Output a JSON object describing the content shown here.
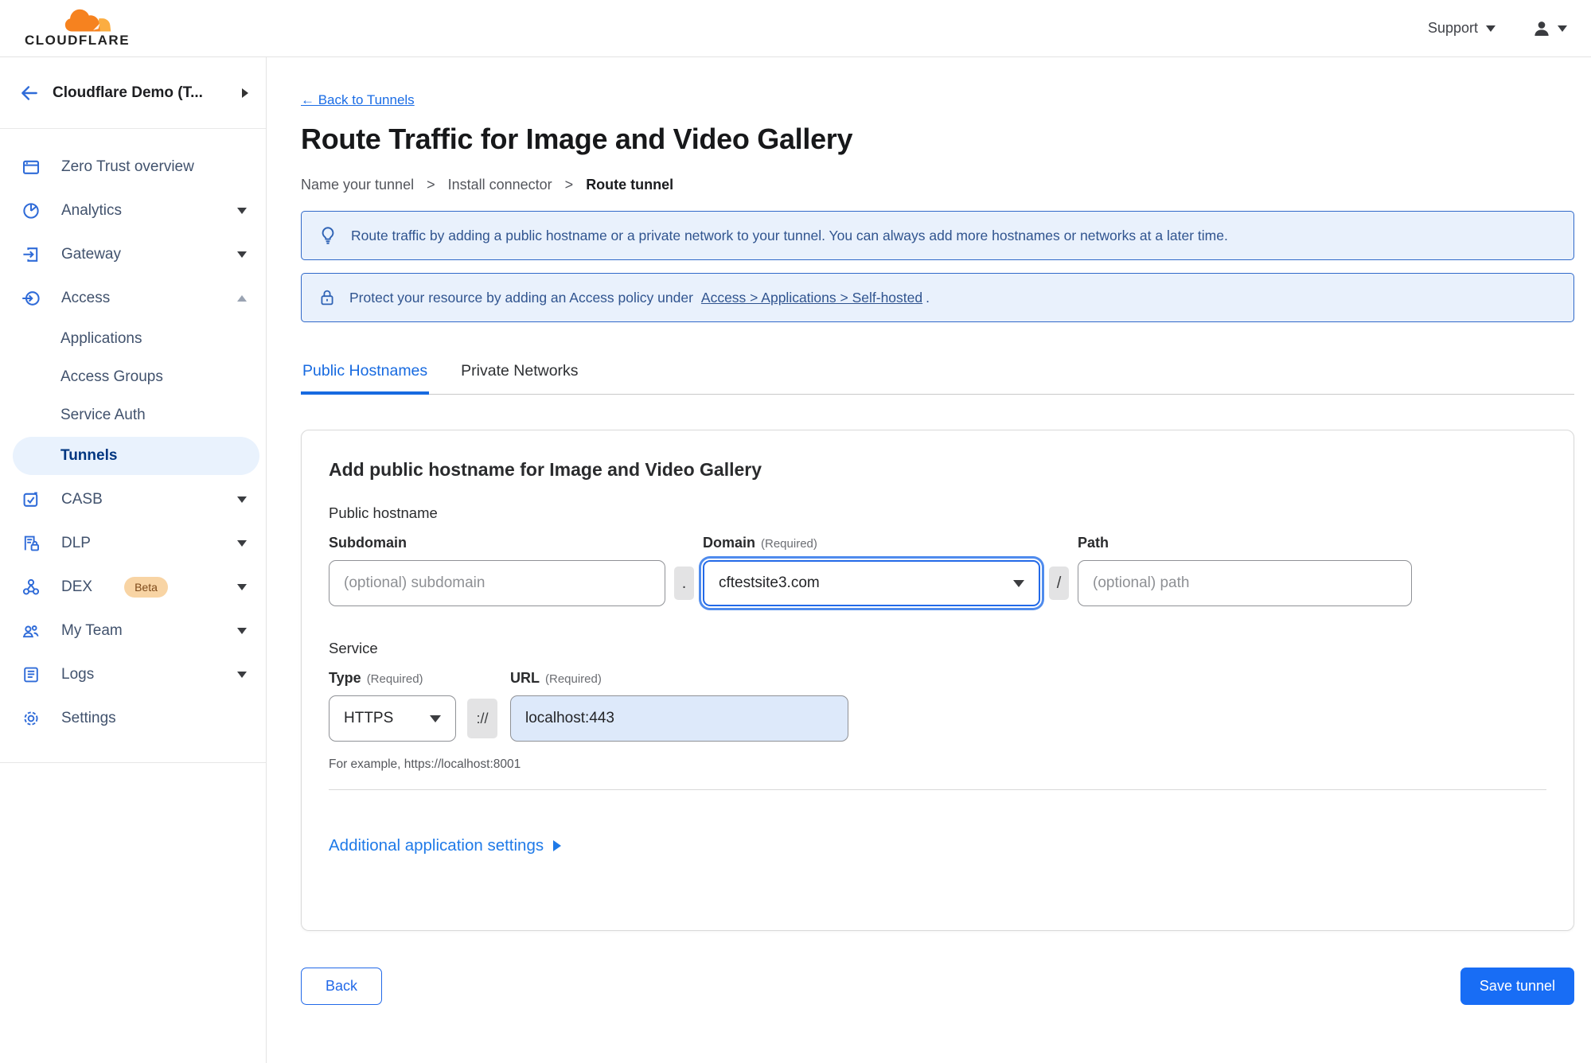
{
  "header": {
    "brand": "CLOUDFLARE",
    "support": "Support"
  },
  "sidebar": {
    "account": "Cloudflare Demo (T...",
    "items": [
      {
        "label": "Zero Trust overview",
        "icon": "overview-icon",
        "chevron": ""
      },
      {
        "label": "Analytics",
        "icon": "analytics-icon",
        "chevron": "down"
      },
      {
        "label": "Gateway",
        "icon": "gateway-icon",
        "chevron": "down"
      },
      {
        "label": "Access",
        "icon": "access-icon",
        "chevron": "up"
      }
    ],
    "access_sub": [
      {
        "label": "Applications"
      },
      {
        "label": "Access Groups"
      },
      {
        "label": "Service Auth"
      },
      {
        "label": "Tunnels",
        "selected": true
      }
    ],
    "items2": [
      {
        "label": "CASB",
        "icon": "casb-icon",
        "chevron": "down",
        "badge": ""
      },
      {
        "label": "DLP",
        "icon": "dlp-icon",
        "chevron": "down",
        "badge": ""
      },
      {
        "label": "DEX",
        "icon": "dex-icon",
        "chevron": "down",
        "badge": "Beta"
      },
      {
        "label": "My Team",
        "icon": "team-icon",
        "chevron": "down",
        "badge": ""
      },
      {
        "label": "Logs",
        "icon": "logs-icon",
        "chevron": "down",
        "badge": ""
      },
      {
        "label": "Settings",
        "icon": "settings-icon",
        "chevron": "",
        "badge": ""
      }
    ]
  },
  "page": {
    "back_link": "← Back to Tunnels",
    "title": "Route Traffic for Image and Video Gallery",
    "breadcrumb": [
      "Name your tunnel",
      "Install connector",
      "Route tunnel"
    ],
    "crumb_sep": ">",
    "banners": [
      {
        "icon": "lightbulb-icon",
        "text": "Route traffic by adding a public hostname or a private network to your tunnel. You can always add more hostnames or networks at a later time."
      },
      {
        "icon": "lock-icon",
        "text": "Protect your resource by adding an Access policy under",
        "link": "Access > Applications > Self-hosted",
        "suffix": "."
      }
    ],
    "tabs": [
      {
        "label": "Public Hostnames"
      },
      {
        "label": "Private Networks"
      }
    ]
  },
  "form": {
    "card_title": "Add public hostname for Image and Video Gallery",
    "public_hostname_label": "Public hostname",
    "subdomain": {
      "label": "Subdomain",
      "placeholder": "(optional) subdomain"
    },
    "dot_separator": ".",
    "domain": {
      "label": "Domain",
      "required": "(Required)",
      "value": "cftestsite3.com"
    },
    "slash_separator": "/",
    "path": {
      "label": "Path",
      "placeholder": "(optional) path"
    },
    "service_label": "Service",
    "type": {
      "label": "Type",
      "required": "(Required)",
      "value": "HTTPS"
    },
    "scheme_separator": "://",
    "url": {
      "label": "URL",
      "required": "(Required)",
      "value": "localhost:443"
    },
    "example": "For example, https://localhost:8001",
    "additional_settings": "Additional application settings"
  },
  "footer": {
    "back": "Back",
    "save": "Save tunnel"
  },
  "colors": {
    "accent": "#186df5",
    "banner_bg": "#e9f1fc",
    "banner_border": "#3069c9",
    "selected_pill": "#e9f2fd",
    "selected_text": "#003681",
    "beta_bg": "#f8d4a4",
    "url_bg": "#dde9fa"
  }
}
